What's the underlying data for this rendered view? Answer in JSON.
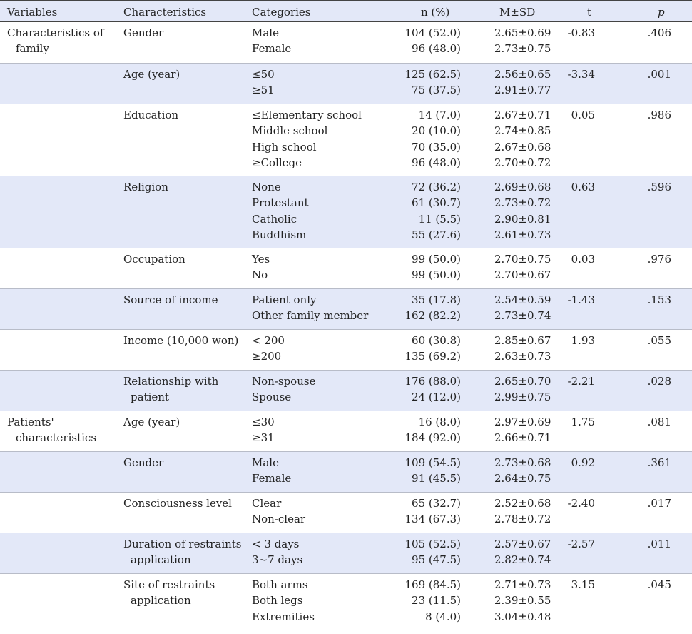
{
  "headers": {
    "variables": "Variables",
    "characteristics": "Characteristics",
    "categories": "Categories",
    "n_pct": "n (%)",
    "msd": "M±SD",
    "t": "t",
    "p": "p"
  },
  "sections": [
    {
      "label_lines": [
        "Characteristics of",
        "family"
      ],
      "first_group": 0
    },
    {
      "label_lines": [
        "Patients'",
        "characteristics"
      ],
      "first_group": 8
    }
  ],
  "groups": [
    {
      "characteristic": [
        "Gender"
      ],
      "t": "-0.83",
      "p": ".406",
      "rows": [
        {
          "category": "Male",
          "n": "104 (52.0)",
          "msd": "2.65±0.69"
        },
        {
          "category": "Female",
          "n": "96 (48.0)",
          "msd": "2.73±0.75"
        }
      ]
    },
    {
      "characteristic": [
        "Age (year)"
      ],
      "t": "-3.34",
      "p": ".001",
      "rows": [
        {
          "category": "≤50",
          "n": "125 (62.5)",
          "msd": "2.56±0.65"
        },
        {
          "category": "≥51",
          "n": "75 (37.5)",
          "msd": "2.91±0.77"
        }
      ]
    },
    {
      "characteristic": [
        "Education"
      ],
      "t": "0.05",
      "p": ".986",
      "rows": [
        {
          "category": "≤Elementary school",
          "n": "14 (7.0)",
          "msd": "2.67±0.71"
        },
        {
          "category": "Middle school",
          "n": "20 (10.0)",
          "msd": "2.74±0.85"
        },
        {
          "category": "High school",
          "n": "70 (35.0)",
          "msd": "2.67±0.68"
        },
        {
          "category": "≥College",
          "n": "96 (48.0)",
          "msd": "2.70±0.72"
        }
      ]
    },
    {
      "characteristic": [
        "Religion"
      ],
      "t": "0.63",
      "p": ".596",
      "rows": [
        {
          "category": "None",
          "n": "72 (36.2)",
          "msd": "2.69±0.68"
        },
        {
          "category": "Protestant",
          "n": "61 (30.7)",
          "msd": "2.73±0.72"
        },
        {
          "category": "Catholic",
          "n": "11 (5.5)",
          "msd": "2.90±0.81"
        },
        {
          "category": "Buddhism",
          "n": "55 (27.6)",
          "msd": "2.61±0.73"
        }
      ]
    },
    {
      "characteristic": [
        "Occupation"
      ],
      "t": "0.03",
      "p": ".976",
      "rows": [
        {
          "category": "Yes",
          "n": "99 (50.0)",
          "msd": "2.70±0.75"
        },
        {
          "category": "No",
          "n": "99 (50.0)",
          "msd": "2.70±0.67"
        }
      ]
    },
    {
      "characteristic": [
        "Source of income"
      ],
      "t": "-1.43",
      "p": ".153",
      "rows": [
        {
          "category": "Patient only",
          "n": "35 (17.8)",
          "msd": "2.54±0.59"
        },
        {
          "category": "Other family member",
          "n": "162 (82.2)",
          "msd": "2.73±0.74"
        }
      ]
    },
    {
      "characteristic": [
        "Income (10,000 won)"
      ],
      "t": "1.93",
      "p": ".055",
      "rows": [
        {
          "category": "< 200",
          "n": "60 (30.8)",
          "msd": "2.85±0.67"
        },
        {
          "category": "≥200",
          "n": "135 (69.2)",
          "msd": "2.63±0.73"
        }
      ]
    },
    {
      "characteristic": [
        "Relationship with",
        "patient"
      ],
      "t": "-2.21",
      "p": ".028",
      "rows": [
        {
          "category": "Non-spouse",
          "n": "176 (88.0)",
          "msd": "2.65±0.70"
        },
        {
          "category": "Spouse",
          "n": "24 (12.0)",
          "msd": "2.99±0.75"
        }
      ]
    },
    {
      "characteristic": [
        "Age (year)"
      ],
      "t": "1.75",
      "p": ".081",
      "rows": [
        {
          "category": "≤30",
          "n": "16 (8.0)",
          "msd": "2.97±0.69"
        },
        {
          "category": "≥31",
          "n": "184 (92.0)",
          "msd": "2.66±0.71"
        }
      ]
    },
    {
      "characteristic": [
        "Gender"
      ],
      "t": "0.92",
      "p": ".361",
      "rows": [
        {
          "category": "Male",
          "n": "109 (54.5)",
          "msd": "2.73±0.68"
        },
        {
          "category": "Female",
          "n": "91 (45.5)",
          "msd": "2.64±0.75"
        }
      ]
    },
    {
      "characteristic": [
        "Consciousness level"
      ],
      "t": "-2.40",
      "p": ".017",
      "rows": [
        {
          "category": "Clear",
          "n": "65 (32.7)",
          "msd": "2.52±0.68"
        },
        {
          "category": "Non-clear",
          "n": "134 (67.3)",
          "msd": "2.78±0.72"
        }
      ]
    },
    {
      "characteristic": [
        "Duration of restraints",
        "application"
      ],
      "t": "-2.57",
      "p": ".011",
      "rows": [
        {
          "category": "< 3 days",
          "n": "105 (52.5)",
          "msd": "2.57±0.67"
        },
        {
          "category": "3~7 days",
          "n": "95 (47.5)",
          "msd": "2.82±0.74"
        }
      ]
    },
    {
      "characteristic": [
        "Site of restraints",
        "application"
      ],
      "t": "3.15",
      "p": ".045",
      "rows": [
        {
          "category": "Both arms",
          "n": "169 (84.5)",
          "msd": "2.71±0.73"
        },
        {
          "category": "Both legs",
          "n": "23 (11.5)",
          "msd": "2.39±0.55"
        },
        {
          "category": "Extremities",
          "n": "8 (4.0)",
          "msd": "3.04±0.48"
        }
      ]
    }
  ]
}
